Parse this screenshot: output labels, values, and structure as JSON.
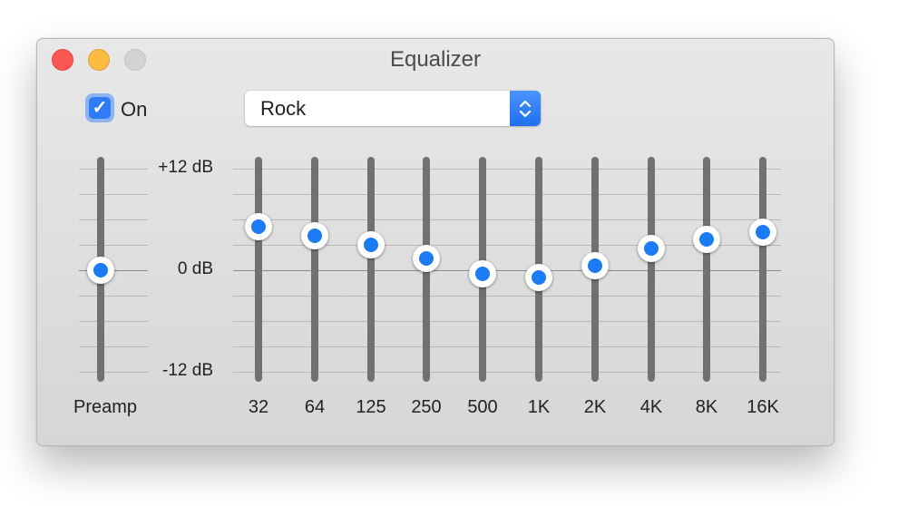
{
  "window": {
    "title": "Equalizer",
    "buttons": [
      "close",
      "minimize",
      "zoom"
    ]
  },
  "toggle": {
    "label": "On",
    "checked": true,
    "check_icon": "✓"
  },
  "preset": {
    "selected": "Rock",
    "icon": "chevron-up-down-icon"
  },
  "scale": {
    "top": "+12 dB",
    "mid": "0 dB",
    "bottom": "-12 dB",
    "min_db": -12,
    "max_db": 12,
    "step_db": 3
  },
  "preamp": {
    "label": "Preamp",
    "value_db": 0
  },
  "bands": [
    {
      "label": "32",
      "value_db": 5.1
    },
    {
      "label": "64",
      "value_db": 4.1
    },
    {
      "label": "125",
      "value_db": 3.0
    },
    {
      "label": "250",
      "value_db": 1.4
    },
    {
      "label": "500",
      "value_db": -0.4
    },
    {
      "label": "1K",
      "value_db": -0.9
    },
    {
      "label": "2K",
      "value_db": 0.5
    },
    {
      "label": "4K",
      "value_db": 2.6
    },
    {
      "label": "8K",
      "value_db": 3.6
    },
    {
      "label": "16K",
      "value_db": 4.5
    }
  ],
  "colors": {
    "accent": "#1b7bf5",
    "close": "#fc5753",
    "minimize": "#fdbc40",
    "zoom_disabled": "#d3d3d3"
  }
}
